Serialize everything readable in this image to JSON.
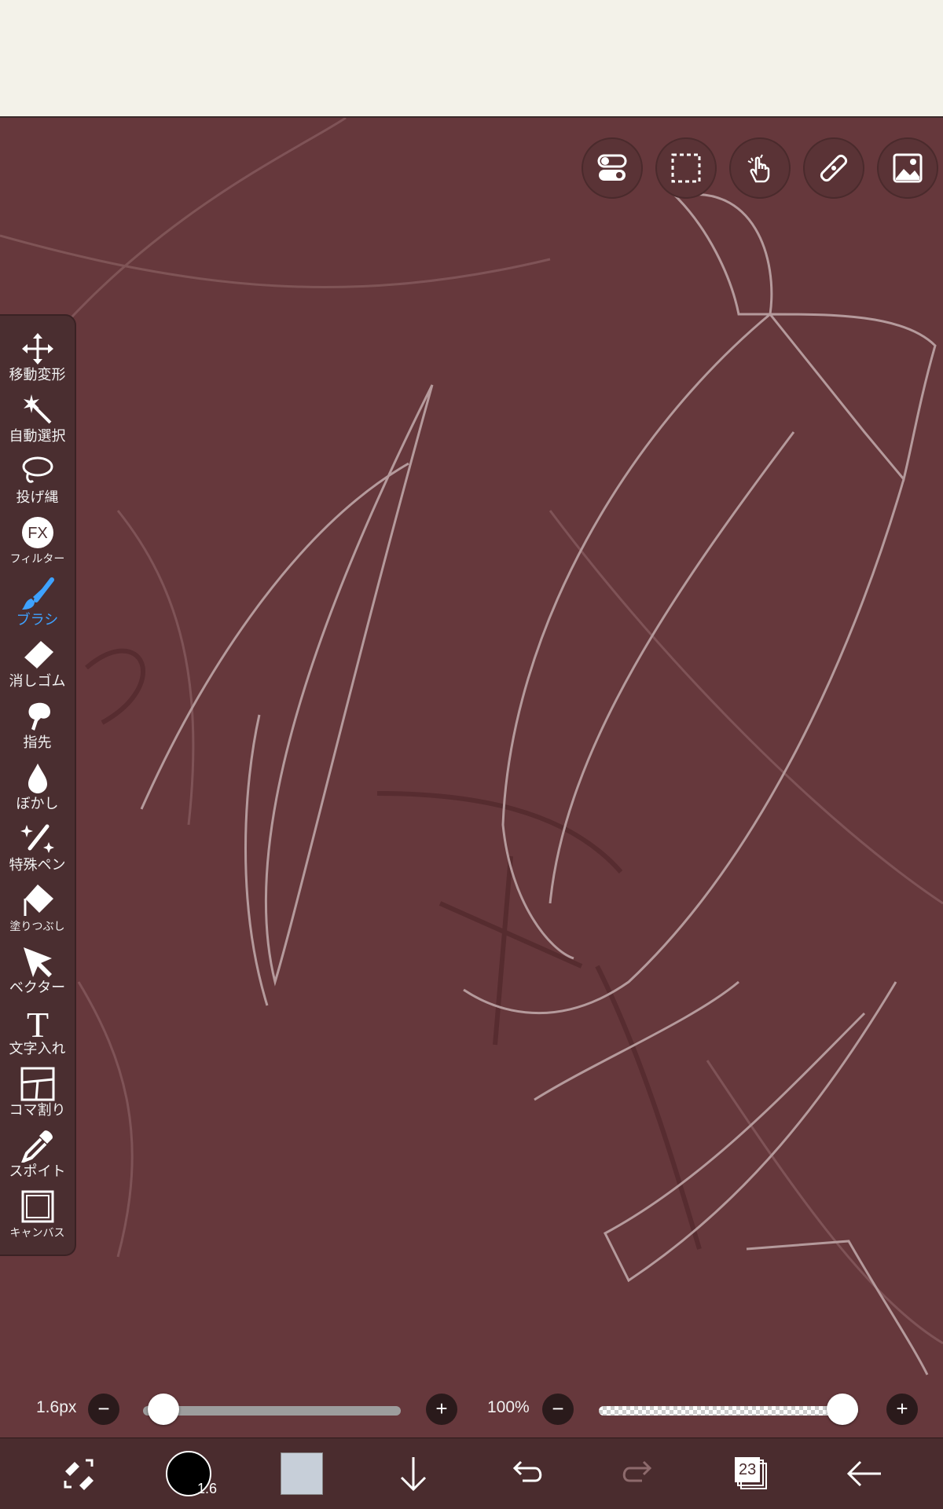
{
  "toolbar_left": [
    {
      "label": "移動変形",
      "icon": "move-transform-icon"
    },
    {
      "label": "自動選択",
      "icon": "magic-wand-icon"
    },
    {
      "label": "投げ縄",
      "icon": "lasso-icon"
    },
    {
      "label": "フィルター",
      "icon": "fx-filter-icon"
    },
    {
      "label": "ブラシ",
      "icon": "brush-icon",
      "active": true
    },
    {
      "label": "消しゴム",
      "icon": "eraser-icon"
    },
    {
      "label": "指先",
      "icon": "finger-smudge-icon"
    },
    {
      "label": "ぼかし",
      "icon": "blur-drop-icon"
    },
    {
      "label": "特殊ペン",
      "icon": "special-pen-icon"
    },
    {
      "label": "塗りつぶし",
      "icon": "bucket-fill-icon"
    },
    {
      "label": "ベクター",
      "icon": "vector-arrow-icon"
    },
    {
      "label": "文字入れ",
      "icon": "text-icon"
    },
    {
      "label": "コマ割り",
      "icon": "frame-divider-icon"
    },
    {
      "label": "スポイト",
      "icon": "eyedropper-icon"
    },
    {
      "label": "キャンバス",
      "icon": "canvas-icon"
    }
  ],
  "top_tools": [
    "toggle-icon",
    "selection-rect-icon",
    "hand-touch-icon",
    "ruler-icon",
    "image-icon"
  ],
  "brush_size": {
    "label": "1.6px",
    "value_fraction": 0.02,
    "minus": "−",
    "plus": "+"
  },
  "opacity": {
    "label": "100%",
    "value_fraction": 1.0,
    "minus": "−",
    "plus": "+"
  },
  "bottom": {
    "brush_size_badge": "1.6",
    "layer_count": "23",
    "color_swatch": "#c7cfd9"
  },
  "colors": {
    "canvas": "#66383c",
    "accent": "#3ea2ff",
    "topbar": "#f3f2e9"
  }
}
